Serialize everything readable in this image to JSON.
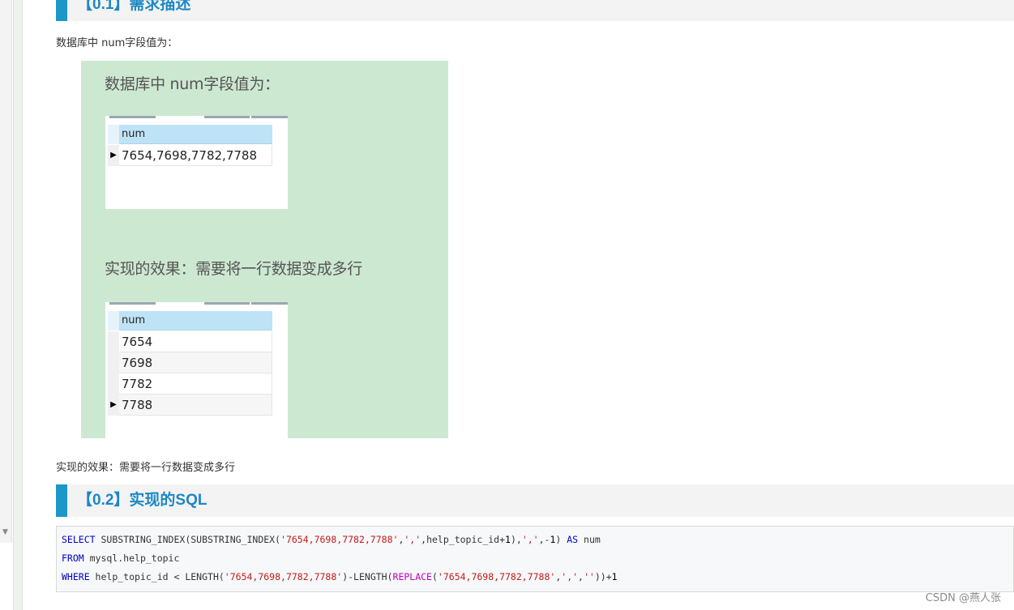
{
  "section1": {
    "heading": "【0.1】需求描述"
  },
  "para1": "数据库中 num字段值为：",
  "figure": {
    "title1": "数据库中 num字段值为：",
    "grid1": {
      "column": "num",
      "rows": [
        "7654,7698,7782,7788"
      ]
    },
    "title2": "实现的效果：需要将一行数据变成多行",
    "grid2": {
      "column": "num",
      "rows": [
        "7654",
        "7698",
        "7782",
        "7788"
      ]
    }
  },
  "para2": "实现的效果：需要将一行数据变成多行",
  "section2": {
    "heading": "【0.2】实现的SQL"
  },
  "code": {
    "line1": {
      "kw1": "SELECT",
      "t1": " SUBSTRING_INDEX(SUBSTRING_INDEX(",
      "s1": "'7654,7698,7782,7788'",
      "t2": ",",
      "s2": "','",
      "t3": ",help_topic_id+",
      "n1": "1",
      "t4": "),",
      "s3": "','",
      "t5": ",-",
      "n2": "1",
      "t6": ") ",
      "kw2": "AS",
      "t7": " num"
    },
    "line2": {
      "kw1": "FROM",
      "t1": " mysql.help_topic"
    },
    "line3": {
      "kw1": "WHERE",
      "t1": " help_topic_id < LENGTH(",
      "s1": "'7654,7698,7782,7788'",
      "t2": ")-LENGTH(",
      "fn1": "REPLACE",
      "t3": "(",
      "s2": "'7654,7698,7782,7788'",
      "t4": ",",
      "s3": "','",
      "t5": ",",
      "s4": "''",
      "t6": "))+",
      "n1": "1"
    }
  },
  "watermark": "CSDN @燕人张"
}
